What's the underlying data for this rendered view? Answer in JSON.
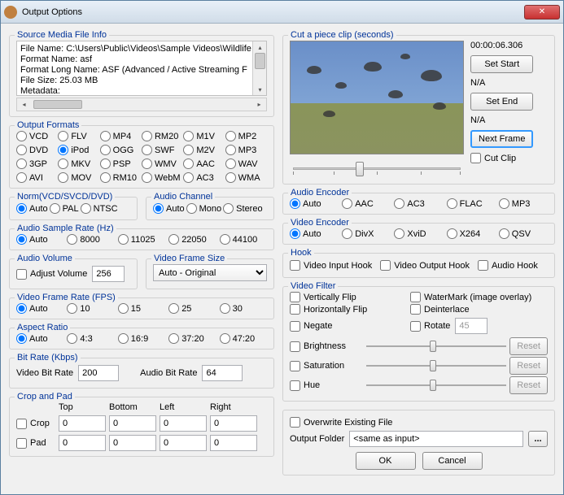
{
  "window": {
    "title": "Output Options"
  },
  "sourceInfo": {
    "label": "Source Media File Info",
    "lines": [
      "File Name: C:\\Users\\Public\\Videos\\Sample Videos\\Wildlife",
      "Format Name: asf",
      "Format Long Name: ASF (Advanced / Active Streaming F",
      "File Size: 25.03 MB",
      "Metadata:"
    ]
  },
  "outputFormats": {
    "label": "Output Formats",
    "items": [
      "VCD",
      "FLV",
      "MP4",
      "RM20",
      "M1V",
      "MP2",
      "DVD",
      "iPod",
      "OGG",
      "SWF",
      "M2V",
      "MP3",
      "3GP",
      "MKV",
      "PSP",
      "WMV",
      "AAC",
      "WAV",
      "AVI",
      "MOV",
      "RM10",
      "WebM",
      "AC3",
      "WMA"
    ],
    "selected": "iPod"
  },
  "norm": {
    "label": "Norm(VCD/SVCD/DVD)",
    "items": [
      "Auto",
      "PAL",
      "NTSC"
    ],
    "selected": "Auto"
  },
  "audioChannel": {
    "label": "Audio Channel",
    "items": [
      "Auto",
      "Mono",
      "Stereo"
    ],
    "selected": "Auto"
  },
  "sampleRate": {
    "label": "Audio Sample Rate (Hz)",
    "items": [
      "Auto",
      "8000",
      "11025",
      "22050",
      "44100"
    ],
    "selected": "Auto"
  },
  "audioVolume": {
    "label": "Audio Volume",
    "adjust": "Adjust Volume",
    "value": "256"
  },
  "frameSize": {
    "label": "Video Frame Size",
    "value": "Auto - Original"
  },
  "fps": {
    "label": "Video Frame Rate (FPS)",
    "items": [
      "Auto",
      "10",
      "15",
      "25",
      "30"
    ],
    "selected": "Auto"
  },
  "aspect": {
    "label": "Aspect Ratio",
    "items": [
      "Auto",
      "4:3",
      "16:9",
      "37:20",
      "47:20"
    ],
    "selected": "Auto"
  },
  "bitrate": {
    "label": "Bit Rate (Kbps)",
    "videoLbl": "Video Bit Rate",
    "video": "200",
    "audioLbl": "Audio Bit Rate",
    "audio": "64"
  },
  "cropPad": {
    "label": "Crop and Pad",
    "hdrs": [
      "Top",
      "Bottom",
      "Left",
      "Right"
    ],
    "crop": "Crop",
    "pad": "Pad",
    "vals": [
      "0",
      "0",
      "0",
      "0"
    ]
  },
  "clip": {
    "label": "Cut a piece clip (seconds)",
    "time": "00:00:06.306",
    "setStart": "Set Start",
    "setEnd": "Set End",
    "start": "N/A",
    "end": "N/A",
    "next": "Next Frame",
    "cut": "Cut Clip"
  },
  "audioEnc": {
    "label": "Audio Encoder",
    "items": [
      "Auto",
      "AAC",
      "AC3",
      "FLAC",
      "MP3"
    ],
    "selected": "Auto"
  },
  "videoEnc": {
    "label": "Video Encoder",
    "items": [
      "Auto",
      "DivX",
      "XviD",
      "X264",
      "QSV"
    ],
    "selected": "Auto"
  },
  "hook": {
    "label": "Hook",
    "items": [
      "Video Input Hook",
      "Video Output Hook",
      "Audio Hook"
    ]
  },
  "filter": {
    "label": "Video Filter",
    "vflip": "Vertically Flip",
    "hflip": "Horizontally Flip",
    "negate": "Negate",
    "watermark": "WaterMark (image overlay)",
    "deint": "Deinterlace",
    "rotate": "Rotate",
    "rotateVal": "45",
    "bright": "Brightness",
    "sat": "Saturation",
    "hue": "Hue",
    "reset": "Reset"
  },
  "output": {
    "overwrite": "Overwrite Existing File",
    "folderLbl": "Output Folder",
    "folder": "<same as input>",
    "ok": "OK",
    "cancel": "Cancel"
  }
}
